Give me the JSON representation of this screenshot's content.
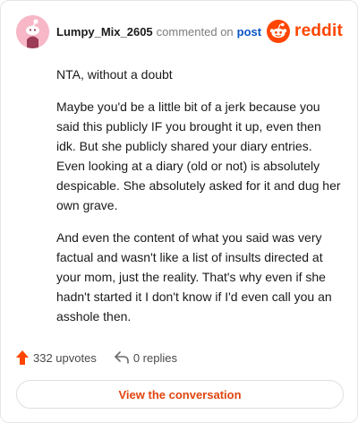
{
  "comment": {
    "username": "Lumpy_Mix_2605",
    "verb": "commented on",
    "link": "post",
    "paragraphs": [
      "NTA, without a doubt",
      "Maybe you'd be a little bit of a jerk because you said this publicly IF you brought it up, even then idk. But she publicly shared your diary entries. Even looking at a diary (old or not) is absolutely despicable. She absolutely asked for it and dug her own grave.",
      "And even the content of what you said was very factual and wasn't like a list of insults directed at your mom, just the reality. That's why even if she hadn't started it I don't know if I'd even call you an asshole then."
    ]
  },
  "brand": {
    "wordmark": "reddit",
    "color": "#ff4500"
  },
  "actions": {
    "upvotes": "332 upvotes",
    "replies": "0 replies"
  },
  "cta": {
    "label": "View the conversation"
  },
  "colors": {
    "accent": "#ff4500",
    "link": "#0b54c4",
    "avatar_bg": "#f7b7c7"
  },
  "icons": [
    "snoo-avatar-icon",
    "reddit-logo-icon",
    "upvote-arrow-icon",
    "reply-arrow-icon"
  ]
}
